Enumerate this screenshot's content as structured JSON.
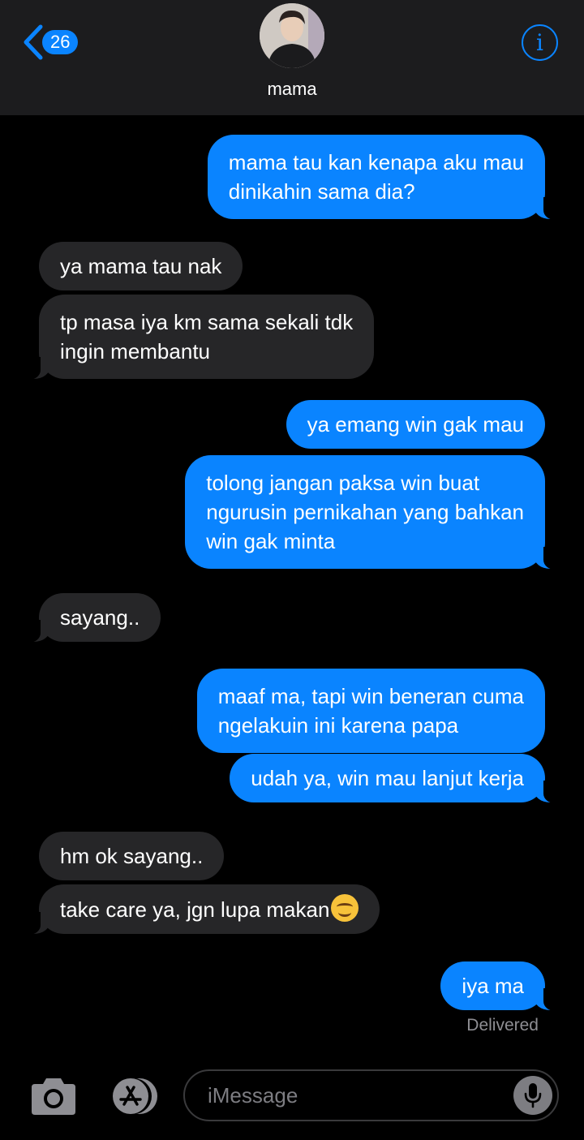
{
  "header": {
    "back_count": "26",
    "contact_name": "mama",
    "info_glyph": "i"
  },
  "messages": [
    {
      "from": "me",
      "lines": [
        "mama tau kan kenapa aku mau",
        "dinikahin sama dia?"
      ]
    },
    {
      "from": "them",
      "lines": [
        "ya mama tau nak"
      ]
    },
    {
      "from": "them",
      "lines": [
        "tp masa iya km sama sekali tdk",
        "ingin membantu"
      ]
    },
    {
      "from": "me",
      "lines": [
        "ya emang win gak mau"
      ]
    },
    {
      "from": "me",
      "lines": [
        "tolong jangan paksa win buat",
        "ngurusin pernikahan yang bahkan",
        "win gak minta"
      ]
    },
    {
      "from": "them",
      "lines": [
        "sayang.."
      ]
    },
    {
      "from": "me",
      "lines": [
        "maaf ma, tapi win beneran cuma",
        "ngelakuin ini karena papa"
      ]
    },
    {
      "from": "me",
      "lines": [
        "udah ya, win mau lanjut kerja"
      ]
    },
    {
      "from": "them",
      "lines": [
        "hm ok sayang.."
      ]
    },
    {
      "from": "them",
      "lines": [
        "take care ya, jgn lupa makan"
      ],
      "emoji": "smiling-face-emoji"
    },
    {
      "from": "me",
      "lines": [
        "iya ma"
      ]
    }
  ],
  "status": "Delivered",
  "composer": {
    "placeholder": "iMessage",
    "camera_icon": "camera-icon",
    "apps_icon": "app-store-icon",
    "mic_icon": "microphone-icon"
  },
  "colors": {
    "sent_bubble": "#0a84ff",
    "received_bubble": "#262628",
    "header_bg": "#1c1c1e",
    "background": "#000000"
  }
}
